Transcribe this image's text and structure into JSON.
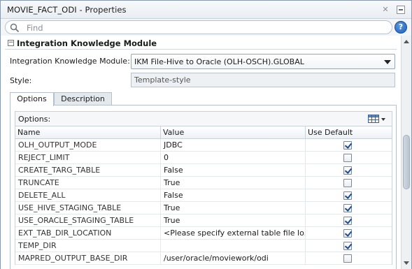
{
  "window": {
    "title": "MOVIE_FACT_ODI - Properties"
  },
  "search": {
    "placeholder": "Find"
  },
  "section": {
    "title": "Integration Knowledge Module"
  },
  "fields": {
    "ikm_label": "Integration Knowledge Module:",
    "ikm_value": "IKM File-Hive to Oracle (OLH-OSCH).GLOBAL",
    "style_label": "Style:",
    "style_value": "Template-style"
  },
  "tabs": [
    {
      "label": "Options",
      "active": true
    },
    {
      "label": "Description",
      "active": false
    }
  ],
  "options": {
    "label": "Options:",
    "columns": [
      "Name",
      "Value",
      "Use Default"
    ],
    "rows": [
      {
        "name": "OLH_OUTPUT_MODE",
        "value": "JDBC",
        "use_default": true
      },
      {
        "name": "REJECT_LIMIT",
        "value": "0",
        "use_default": false
      },
      {
        "name": "CREATE_TARG_TABLE",
        "value": "False",
        "use_default": true
      },
      {
        "name": "TRUNCATE",
        "value": "True",
        "use_default": false
      },
      {
        "name": "DELETE_ALL",
        "value": "False",
        "use_default": true
      },
      {
        "name": "USE_HIVE_STAGING_TABLE",
        "value": "True",
        "use_default": true
      },
      {
        "name": "USE_ORACLE_STAGING_TABLE",
        "value": "True",
        "use_default": true
      },
      {
        "name": "EXT_TAB_DIR_LOCATION",
        "value": "<Please specify external table file lo...",
        "use_default": true
      },
      {
        "name": "TEMP_DIR",
        "value": "",
        "use_default": true
      },
      {
        "name": "MAPRED_OUTPUT_BASE_DIR",
        "value": "/user/oracle/moviework/odi",
        "use_default": false
      }
    ]
  },
  "icons": {
    "close": "close-icon",
    "minimize": "minimize-icon",
    "search": "search-icon",
    "help": "help-icon",
    "grid": "table-view-icon"
  },
  "colors": {
    "help_blue": "#1f5fb5",
    "check_blue": "#1c4b8f"
  }
}
